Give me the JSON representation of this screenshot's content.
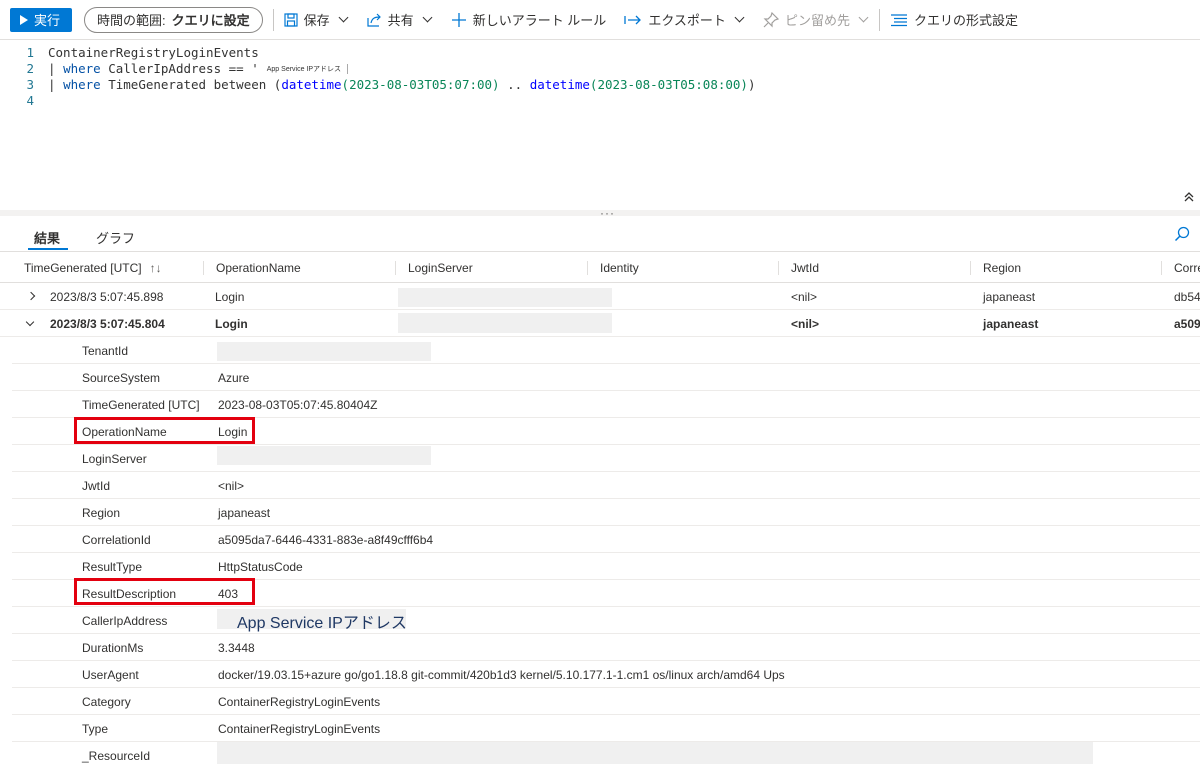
{
  "toolbar": {
    "run_label": "実行",
    "time_range_label": "時間の範囲:",
    "time_range_value": "クエリに設定",
    "save_label": "保存",
    "share_label": "共有",
    "new_alert_label": "新しいアラート ルール",
    "export_label": "エクスポート",
    "pin_label": "ピン留め先",
    "format_label": "クエリの形式設定"
  },
  "editor": {
    "lines": [
      {
        "num": "1",
        "text": "ContainerRegistryLoginEvents"
      },
      {
        "num": "2",
        "prefix": "| ",
        "kw": "where",
        "text": " CallerIpAddress == '",
        "chip": "App Service IPアドレス"
      },
      {
        "num": "3",
        "prefix": "| ",
        "kw": "where",
        "text": " TimeGenerated between (",
        "fn1": "datetime",
        "arg1": "(2023-08-03T05:07:00)",
        "mid": " .. ",
        "fn2": "datetime",
        "arg2": "(2023-08-03T05:08:00)",
        "end": ")"
      },
      {
        "num": "4",
        "text": ""
      }
    ]
  },
  "results": {
    "tabs": [
      "結果",
      "グラフ"
    ],
    "columns": [
      "TimeGenerated [UTC]",
      "OperationName",
      "LoginServer",
      "Identity",
      "JwtId",
      "Region",
      "Corre"
    ],
    "sort_icon": "↑↓",
    "rows": [
      {
        "time": "2023/8/3 5:07:45.898",
        "operation": "Login",
        "jwtid": "<nil>",
        "region": "japaneast",
        "corr": "db54"
      },
      {
        "time": "2023/8/3 5:07:45.804",
        "operation": "Login",
        "jwtid": "<nil>",
        "region": "japaneast",
        "corr": "a509"
      }
    ],
    "details": [
      {
        "key": "TenantId",
        "value": ""
      },
      {
        "key": "SourceSystem",
        "value": "Azure"
      },
      {
        "key": "TimeGenerated [UTC]",
        "value": "2023-08-03T05:07:45.80404Z"
      },
      {
        "key": "OperationName",
        "value": "Login"
      },
      {
        "key": "LoginServer",
        "value": ""
      },
      {
        "key": "JwtId",
        "value": "<nil>"
      },
      {
        "key": "Region",
        "value": "japaneast"
      },
      {
        "key": "CorrelationId",
        "value": "a5095da7-6446-4331-883e-a8f49cfff6b4"
      },
      {
        "key": "ResultType",
        "value": "HttpStatusCode"
      },
      {
        "key": "ResultDescription",
        "value": "403"
      },
      {
        "key": "CallerIpAddress",
        "value": "App Service IPアドレス"
      },
      {
        "key": "DurationMs",
        "value": "3.3448"
      },
      {
        "key": "UserAgent",
        "value": "docker/19.03.15+azure go/go1.18.8 git-commit/420b1d3 kernel/5.10.177.1-1.cm1 os/linux arch/amd64 Ups"
      },
      {
        "key": "Category",
        "value": "ContainerRegistryLoginEvents"
      },
      {
        "key": "Type",
        "value": "ContainerRegistryLoginEvents"
      },
      {
        "key": "_ResourceId",
        "value": ""
      }
    ]
  },
  "colors": {
    "accent": "#0078d4",
    "highlight": "#e3000f"
  }
}
